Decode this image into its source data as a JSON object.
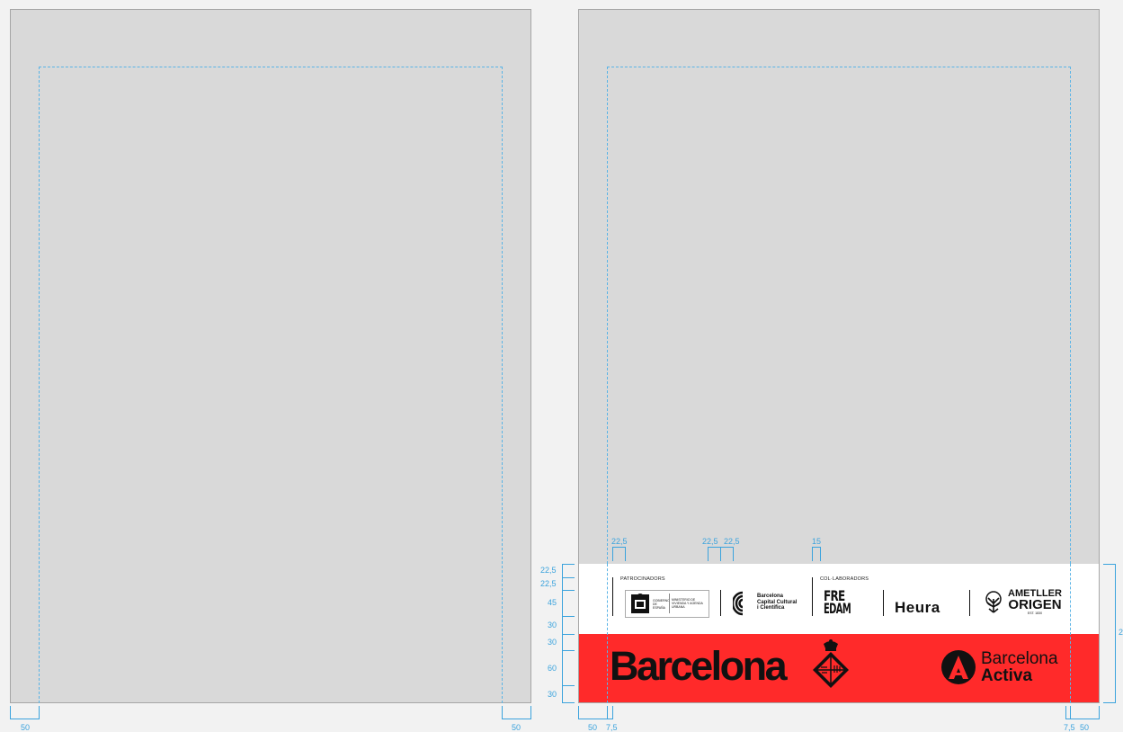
{
  "dimensions": {
    "bottom_left": [
      "50",
      "50"
    ],
    "bottom_right": [
      "50",
      "7,5",
      "7,5",
      "50"
    ],
    "top_spacing": [
      "22,5",
      "22,5",
      "22,5",
      "15"
    ],
    "left_stack": [
      "22,5",
      "22,5",
      "45",
      "30",
      "30",
      "60",
      "30"
    ],
    "right_total": "2"
  },
  "footer": {
    "sponsors_label": "PATROCINADORS",
    "collaborators_label": "COL·LABORADORS",
    "gov_logo_text": [
      "GOBIERNO DE ESPAÑA",
      "MINISTERIO DE VIVIENDA Y AGENDA URBANA"
    ],
    "bcc_logo_text": [
      "Barcelona",
      "Capital Cultural",
      "i Científica"
    ],
    "freedam_text": [
      "FRE",
      "EDAM"
    ],
    "heura_text": "Heura",
    "ametller_text": [
      "AMETLLER",
      "ORIGEN",
      "EST. 1830"
    ],
    "barcelona_text": "Barcelona",
    "activa_text": [
      "Barcelona",
      "Activa"
    ],
    "colors": {
      "red": "#ff2a2a",
      "dimension_blue": "#3ba3dd",
      "page_gray": "#d9d9d9"
    }
  }
}
